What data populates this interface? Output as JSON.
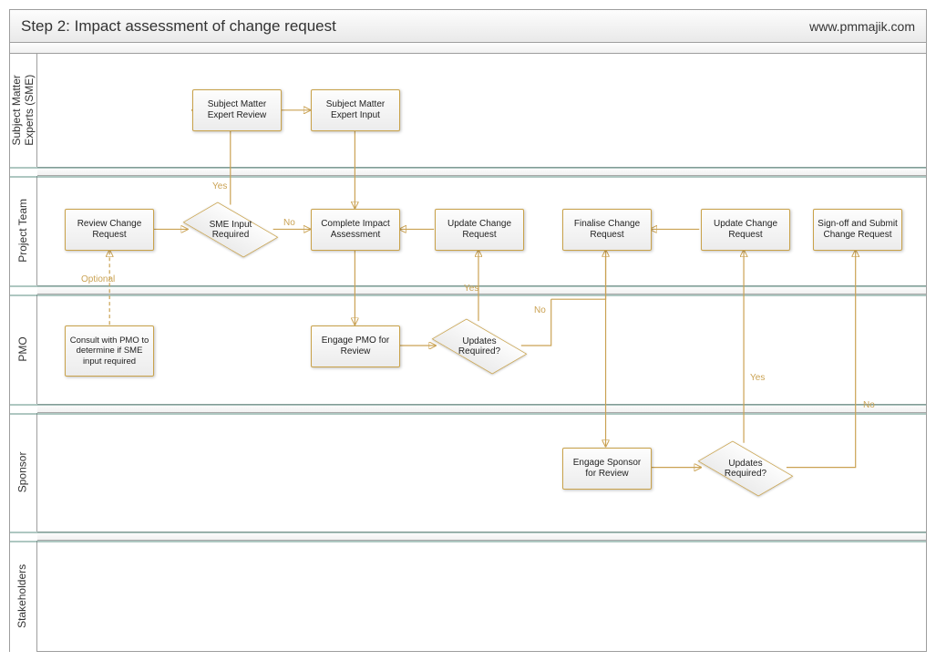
{
  "header": {
    "title": "Step 2: Impact assessment of change request",
    "url": "www.pmmajik.com"
  },
  "lanes": {
    "sme": "Subject Matter\nExperts (SME)",
    "team": "Project Team",
    "pmo": "PMO",
    "sponsor": "Sponsor",
    "stake": "Stakeholders"
  },
  "nodes": {
    "sme_review": "Subject Matter Expert Review",
    "sme_input": "Subject Matter Expert Input",
    "review_cr": "Review Change Request",
    "sme_req": "SME Input Required",
    "complete": "Complete Impact Assessment",
    "update1": "Update Change Request",
    "finalise": "Finalise Change Request",
    "update2": "Update Change Request",
    "signoff": "Sign-off and Submit Change Request",
    "consult_pmo": "Consult with PMO to determine if SME input required",
    "engage_pmo": "Engage PMO for Review",
    "updates_pmo": "Updates Required?",
    "engage_spon": "Engage Sponsor for Review",
    "updates_spon": "Updates Required?"
  },
  "labels": {
    "yes": "Yes",
    "no": "No",
    "optional": "Optional"
  }
}
